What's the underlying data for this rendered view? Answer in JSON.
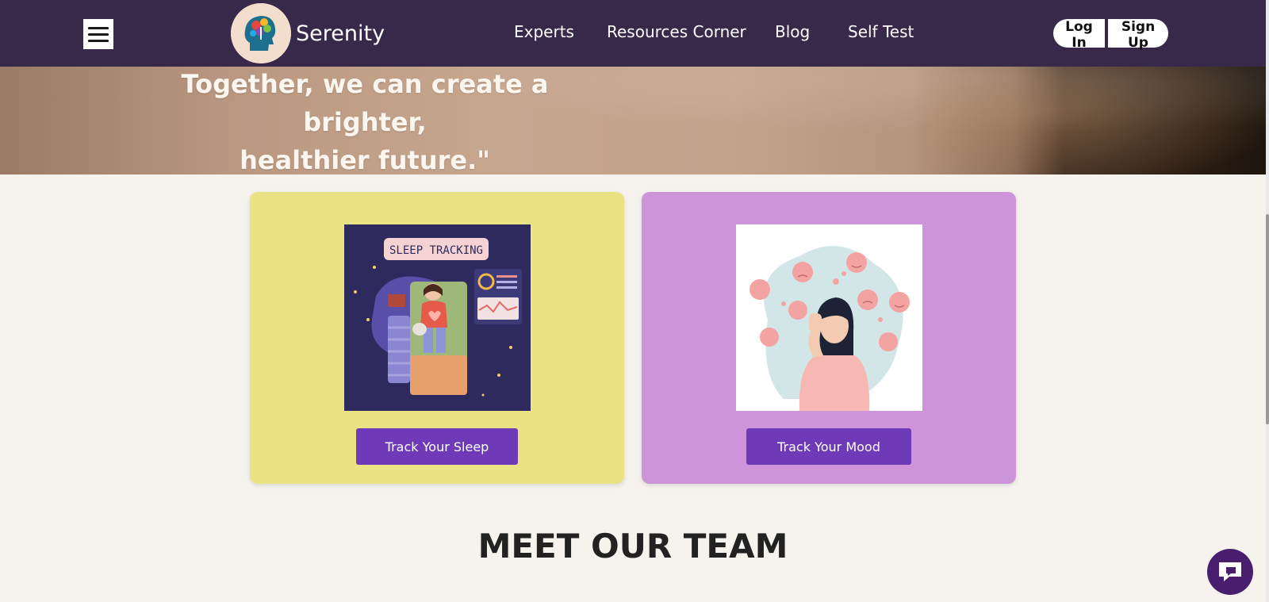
{
  "brand": {
    "name": "Serenity"
  },
  "nav": {
    "links": [
      "Experts",
      "Resources Corner",
      "Blog",
      "Self Test"
    ],
    "login_label": "Log In",
    "signup_label": "Sign Up"
  },
  "hero": {
    "quote_line1": "Together, we can create a brighter,",
    "quote_line2": "healthier future.\""
  },
  "cards": {
    "sleep": {
      "image_caption": "SLEEP TRACKING",
      "button_label": "Track Your Sleep"
    },
    "mood": {
      "button_label": "Track Your Mood"
    }
  },
  "team": {
    "heading": "MEET OUR TEAM"
  },
  "colors": {
    "navbar": "#38294a",
    "sleep_card": "#ebe283",
    "mood_card": "#cd94da",
    "button": "#6e3ab8",
    "chat_button": "#4a1e6e"
  },
  "icons": {
    "menu": "hamburger-menu-icon",
    "chat": "chat-bubble-icon",
    "logo": "head-logo-icon"
  }
}
